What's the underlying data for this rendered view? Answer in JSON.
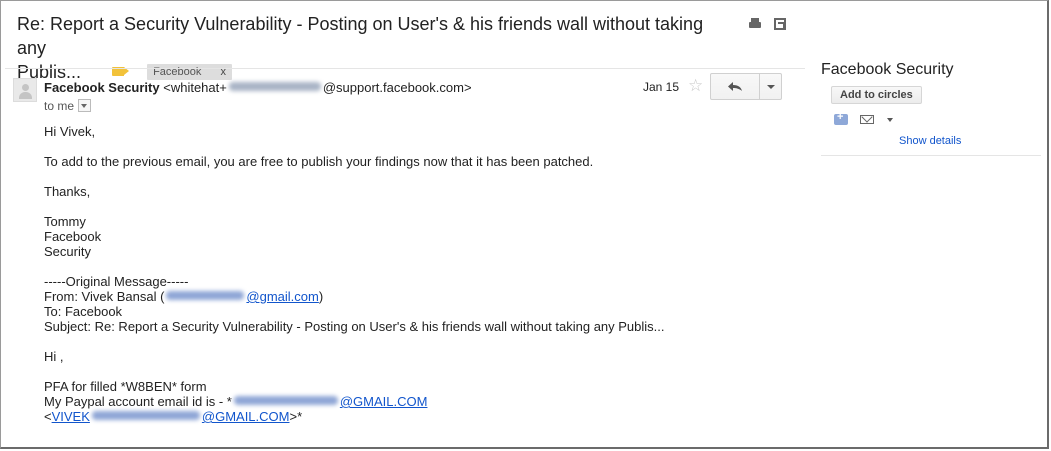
{
  "email": {
    "subject_line1": "Re: Report a Security Vulnerability - Posting on User's & his friends wall without taking any",
    "subject_line2": "Publis...",
    "label_chip": "Facebook",
    "label_chip_remove": "x",
    "sender_name": "Facebook Security",
    "sender_email_prefix": "<whitehat+",
    "sender_email_suffix": "@support.facebook.com>",
    "to_text": "to me",
    "date": "Jan 15",
    "star_glyph": "☆",
    "body": {
      "greeting": "Hi Vivek,",
      "line1": "To add to the previous email, you are free to publish your findings now that it has been patched.",
      "thanks": "Thanks,",
      "sig_name": "Tommy",
      "sig_company": "Facebook",
      "sig_team": "Security",
      "orig_header": "-----Original Message-----",
      "from_prefix": "From: Vivek Bansal (",
      "from_link_suffix": "@gmail.com",
      "from_close": ")",
      "to_line": "To: Facebook",
      "subject_line": "Subject: Re: Report a Security Vulnerability - Posting on User's & his friends wall without taking any Publis...",
      "hi": "Hi ,",
      "pfa": "PFA for filled *W8BEN* form",
      "paypal_prefix": "My Paypal account email id is - *",
      "paypal_link_suffix": "@GMAIL.COM",
      "last_prefix": "<",
      "last_link_start": "VIVEK",
      "last_link_suffix": "@GMAIL.COM",
      "last_close": ">*"
    }
  },
  "sidebar": {
    "name": "Facebook Security",
    "add_button": "Add to circles",
    "show_details": "Show details"
  },
  "colors": {
    "link": "#1155cc",
    "label_tag": "#f2c23a",
    "chip_bg": "#dddddd"
  }
}
